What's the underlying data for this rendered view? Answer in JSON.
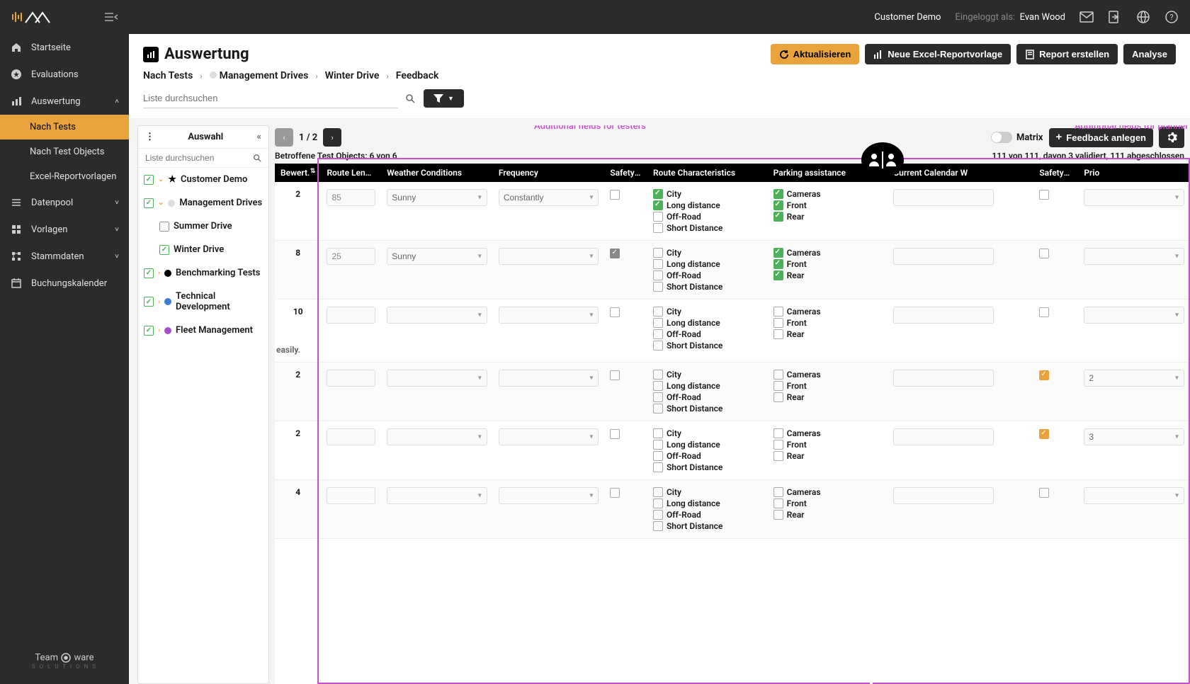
{
  "topbar": {
    "customer": "Customer Demo",
    "logged_label": "Eingeloggt als:",
    "user": "Evan Wood"
  },
  "sidebar": {
    "items": [
      {
        "icon": "home",
        "label": "Startseite"
      },
      {
        "icon": "star",
        "label": "Evaluations"
      },
      {
        "icon": "chart",
        "label": "Auswertung",
        "expanded": true,
        "children": [
          {
            "label": "Nach Tests",
            "active": true
          },
          {
            "label": "Nach Test Objects"
          },
          {
            "label": "Excel-Reportvorlagen"
          }
        ]
      },
      {
        "icon": "db",
        "label": "Datenpool",
        "chev": true
      },
      {
        "icon": "tmpl",
        "label": "Vorlagen",
        "chev": true
      },
      {
        "icon": "master",
        "label": "Stammdaten",
        "chev": true
      },
      {
        "icon": "cal",
        "label": "Buchungskalender"
      }
    ],
    "footer": "Team     ware"
  },
  "page": {
    "title": "Auswertung",
    "actions": {
      "refresh": "Aktualisieren",
      "new_excel": "Neue Excel-Reportvorlage",
      "create_report": "Report erstellen",
      "analyse": "Analyse"
    },
    "breadcrumb": [
      "Nach Tests",
      "Management Drives",
      "Winter Drive",
      "Feedback"
    ],
    "search_placeholder": "Liste durchsuchen"
  },
  "selection": {
    "title": "Auswahl",
    "search_placeholder": "Liste durchsuchen",
    "tree": [
      {
        "depth": 0,
        "cb": "some",
        "chev": "down",
        "dot": null,
        "star": true,
        "label": "Customer Demo"
      },
      {
        "depth": 0,
        "cb": "checked",
        "chev": "down",
        "dot": "#ddd",
        "label": "Management Drives"
      },
      {
        "depth": 2,
        "cb": "empty",
        "label": "Summer Drive"
      },
      {
        "depth": 2,
        "cb": "checked",
        "label": "Winter Drive"
      },
      {
        "depth": 0,
        "cb": "some",
        "chev": "right",
        "dot": "#000",
        "label": "Benchmarking Tests"
      },
      {
        "depth": 0,
        "cb": "some",
        "chev": "right",
        "dot": "#3b7dd8",
        "label": "Technical Development"
      },
      {
        "depth": 0,
        "cb": "some",
        "chev": "right",
        "dot": "#a24fc9",
        "label": "Fleet Management"
      }
    ]
  },
  "toolbar": {
    "page_text": "1 / 2",
    "affected": "Betroffene Test Objects: 6 von 6",
    "matrix_label": "Matrix",
    "create_feedback": "Feedback anlegen",
    "status_text": "111 von 111, davon 3 validiert, 111 abgeschlossen"
  },
  "annotations": {
    "testers": "Additional fields for testers",
    "planner": "Additional fields for planner"
  },
  "columns": [
    "Bewert.",
    "Route Length (",
    "Weather Conditions",
    "Frequency",
    "Safety R",
    "Route Characteristics",
    "Parking assistance",
    "Current Calendar W",
    "",
    "Safety-re",
    "Prio"
  ],
  "route_opts": [
    "City",
    "Long distance",
    "Off-Road",
    "Short Distance"
  ],
  "parking_opts": [
    "Cameras",
    "Front",
    "Rear"
  ],
  "rows": [
    {
      "bewert": "2",
      "route_len": "85",
      "weather": "Sunny",
      "freq": "Constantly",
      "safety": false,
      "route_chk": [
        true,
        true,
        false,
        false
      ],
      "parking_chk": [
        true,
        true,
        true
      ],
      "cal": "",
      "safety_re": false,
      "prio": ""
    },
    {
      "bewert": "8",
      "route_len": "25",
      "weather": "Sunny",
      "freq": "",
      "safety": "mixed",
      "route_chk": [
        false,
        false,
        false,
        false
      ],
      "parking_chk": [
        true,
        true,
        true
      ],
      "cal": "",
      "safety_re": false,
      "prio": ""
    },
    {
      "bewert": "10",
      "route_len": "",
      "weather": "",
      "freq": "",
      "safety": false,
      "route_chk": [
        false,
        false,
        false,
        false
      ],
      "parking_chk": [
        false,
        false,
        false
      ],
      "cal": "",
      "safety_re": false,
      "prio": "",
      "note": "easily."
    },
    {
      "bewert": "2",
      "route_len": "",
      "weather": "",
      "freq": "",
      "safety": false,
      "route_chk": [
        false,
        false,
        false,
        false
      ],
      "parking_chk": [
        false,
        false,
        false
      ],
      "cal": "",
      "safety_re": "orange",
      "prio": "2"
    },
    {
      "bewert": "2",
      "route_len": "",
      "weather": "",
      "freq": "",
      "safety": false,
      "route_chk": [
        false,
        false,
        false,
        false
      ],
      "parking_chk": [
        false,
        false,
        false
      ],
      "cal": "",
      "safety_re": "orange",
      "prio": "3"
    },
    {
      "bewert": "4",
      "route_len": "",
      "weather": "",
      "freq": "",
      "safety": false,
      "route_chk": [
        false,
        false,
        false,
        false
      ],
      "parking_chk": [
        false,
        false,
        false
      ],
      "cal": "",
      "safety_re": false,
      "prio": ""
    }
  ]
}
